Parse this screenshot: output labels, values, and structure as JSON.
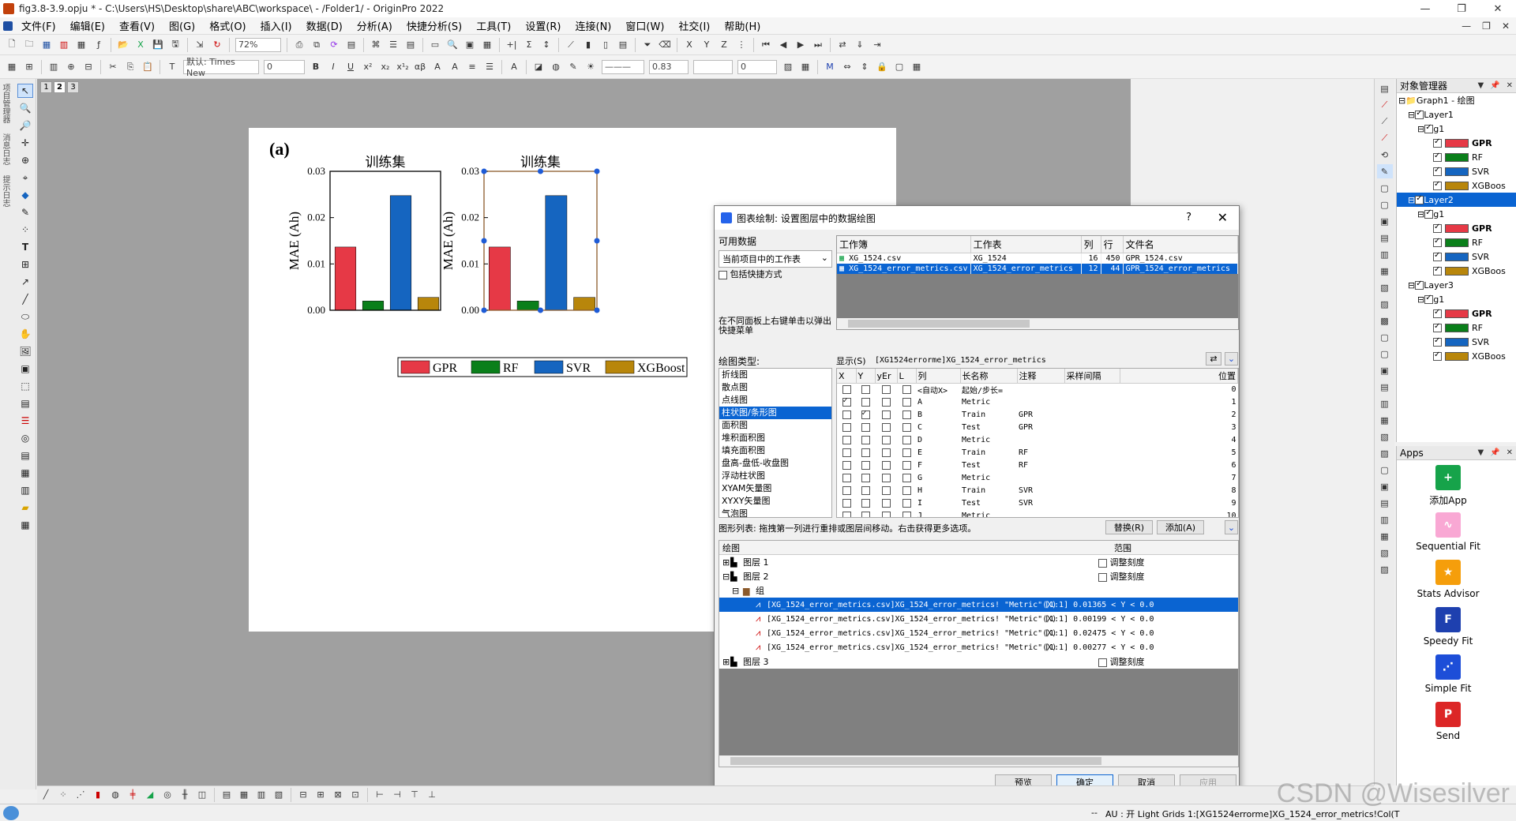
{
  "window": {
    "title": "fig3.8-3.9.opju * - C:\\Users\\HS\\Desktop\\share\\ABC\\workspace\\ - /Folder1/ - OriginPro 2022",
    "controls": [
      "—",
      "❐",
      "✕"
    ]
  },
  "menu": {
    "items": [
      "文件(F)",
      "编辑(E)",
      "查看(V)",
      "图(G)",
      "格式(O)",
      "插入(I)",
      "数据(D)",
      "分析(A)",
      "快捷分析(S)",
      "工具(T)",
      "设置(R)",
      "连接(N)",
      "窗口(W)",
      "社交(I)",
      "帮助(H)"
    ],
    "mdi_controls": [
      "—",
      "❐",
      "✕"
    ]
  },
  "toolbar": {
    "zoom": "72%",
    "font": "默认: Times New",
    "font_size": "0",
    "line_width": "0.83",
    "line_value": "0",
    "style_buttons": [
      "B",
      "I",
      "U",
      "x²",
      "x₂",
      "x¹₂",
      "αβ",
      "A",
      "A"
    ]
  },
  "left_side_labels": [
    "项目管理器",
    "消息日志",
    "提示日志"
  ],
  "page_tabs": [
    "1",
    "2",
    "3"
  ],
  "graph": {
    "panel_label": "(a)",
    "legend": [
      {
        "name": "GPR",
        "color": "#e63946"
      },
      {
        "name": "RF",
        "color": "#0a7f1a"
      },
      {
        "name": "SVR",
        "color": "#1565c0"
      },
      {
        "name": "XGBoost",
        "color": "#b8860b"
      }
    ]
  },
  "chart_data": [
    {
      "type": "bar",
      "title": "训练集",
      "ylabel": "MAE (Ah)",
      "categories": [
        "GPR",
        "RF",
        "SVR",
        "XGBoost"
      ],
      "values": [
        0.01365,
        0.00199,
        0.02475,
        0.00277
      ],
      "ylim": [
        0,
        0.03
      ],
      "yticks": [
        "0.00",
        "0.01",
        "0.02",
        "0.03"
      ],
      "colors": [
        "#e63946",
        "#0a7f1a",
        "#1565c0",
        "#b8860b"
      ]
    },
    {
      "type": "bar",
      "title": "训练集",
      "ylabel": "MAE (Ah)",
      "categories": [
        "GPR",
        "RF",
        "SVR",
        "XGBoost"
      ],
      "values": [
        0.01365,
        0.00199,
        0.02475,
        0.00277
      ],
      "ylim": [
        0,
        0.03
      ],
      "yticks": [
        "0.00",
        "0.01",
        "0.02",
        "0.03"
      ],
      "colors": [
        "#e63946",
        "#0a7f1a",
        "#1565c0",
        "#b8860b"
      ]
    }
  ],
  "dialog": {
    "title": "图表绘制: 设置图层中的数据绘图",
    "help": "?",
    "close": "✕",
    "available_data_label": "可用数据",
    "source_combo": "当前项目中的工作表",
    "include_shortcuts": "包括快捷方式",
    "right_click_hint": "在不同面板上右键单击以弹出快捷菜单",
    "workbook_headers": [
      "工作簿",
      "工作表",
      "列",
      "行",
      "文件名"
    ],
    "workbooks": [
      {
        "book": "XG_1524.csv",
        "sheet": "XG_1524",
        "cols": "16",
        "rows": "450",
        "file": "GPR_1524.csv",
        "selected": false
      },
      {
        "book": "XG_1524_error_metrics.csv",
        "sheet": "XG_1524_error_metrics",
        "cols": "12",
        "rows": "44",
        "file": "GPR_1524_error_metrics",
        "selected": true
      }
    ],
    "plot_type_label": "绘图类型:",
    "plot_types": [
      "折线图",
      "散点图",
      "点线图",
      "柱状图/条形图",
      "面积图",
      "堆积面积图",
      "填充面积图",
      "盘高-盘低-收盘图",
      "浮动柱状图",
      "XYAM矢量图",
      "XYXY矢量图",
      "气泡图"
    ],
    "plot_type_selected": 3,
    "show_label": "显示(S)",
    "show_value": "[XG1524errorme]XG_1524_error_metrics",
    "col_headers": [
      "X",
      "Y",
      "yEr",
      "L",
      "列",
      "长名称",
      "注释",
      "采样间隔",
      "位置"
    ],
    "columns": [
      {
        "x": false,
        "y": false,
        "col": "<自动X>",
        "long": "起始/步长=",
        "comment": "",
        "pos": "0"
      },
      {
        "x": true,
        "y": false,
        "col": "A",
        "long": "Metric",
        "comment": "",
        "pos": "1"
      },
      {
        "x": false,
        "y": true,
        "col": "B",
        "long": "Train",
        "comment": "GPR",
        "pos": "2"
      },
      {
        "x": false,
        "y": false,
        "col": "C",
        "long": "Test",
        "comment": "GPR",
        "pos": "3"
      },
      {
        "x": false,
        "y": false,
        "col": "D",
        "long": "Metric",
        "comment": "",
        "pos": "4"
      },
      {
        "x": false,
        "y": false,
        "col": "E",
        "long": "Train",
        "comment": "RF",
        "pos": "5"
      },
      {
        "x": false,
        "y": false,
        "col": "F",
        "long": "Test",
        "comment": "RF",
        "pos": "6"
      },
      {
        "x": false,
        "y": false,
        "col": "G",
        "long": "Metric",
        "comment": "",
        "pos": "7"
      },
      {
        "x": false,
        "y": false,
        "col": "H",
        "long": "Train",
        "comment": "SVR",
        "pos": "8"
      },
      {
        "x": false,
        "y": false,
        "col": "I",
        "long": "Test",
        "comment": "SVR",
        "pos": "9"
      },
      {
        "x": false,
        "y": false,
        "col": "J",
        "long": "Metric",
        "comment": "",
        "pos": "10"
      }
    ],
    "plotlist_hint": "图形列表: 拖拽第一列进行重排或图层间移动。右击获得更多选项。",
    "replace_btn": "替换(R)",
    "add_btn": "添加(A)",
    "plotlist_headers": [
      "绘图",
      "范围"
    ],
    "layers": [
      {
        "label": "图层 1",
        "rescale": "调整刻度"
      },
      {
        "label": "图层 2",
        "rescale": "调整刻度"
      },
      {
        "label": "图层 3",
        "rescale": "调整刻度"
      }
    ],
    "group_label": "组",
    "plots": [
      {
        "text": "[XG_1524_error_metrics.csv]XG_1524_error_metrics! \"Metric\"(X), \"Train\"(Y)",
        "range": "[1:1]  0.01365 < Y < 0.0",
        "selected": true
      },
      {
        "text": "[XG_1524_error_metrics.csv]XG_1524_error_metrics! \"Metric\"(X), \"Train\"(Y)",
        "range": "[1:1]  0.00199 < Y < 0.0",
        "selected": false
      },
      {
        "text": "[XG_1524_error_metrics.csv]XG_1524_error_metrics! \"Metric\"(X), \"Train\"(Y)",
        "range": "[1:1]  0.02475 < Y < 0.0",
        "selected": false
      },
      {
        "text": "[XG_1524_error_metrics.csv]XG_1524_error_metrics! \"Metric\"(X), \"Train\"(Y)",
        "range": "[1:1]  0.00277 < Y < 0.0",
        "selected": false
      }
    ],
    "preview_btn": "预览",
    "ok_btn": "确定",
    "cancel_btn": "取消",
    "apply_btn": "应用"
  },
  "object_manager": {
    "title": "对象管理器",
    "root": "Graph1 - 绘图",
    "layers": [
      {
        "name": "Layer1",
        "group": "g1",
        "selected": false
      },
      {
        "name": "Layer2",
        "group": "g1",
        "selected": true
      },
      {
        "name": "Layer3",
        "group": "g1",
        "selected": false
      }
    ],
    "series": [
      {
        "name": "GPR",
        "color": "#e63946",
        "bold": true
      },
      {
        "name": "RF",
        "color": "#0a7f1a",
        "bold": false
      },
      {
        "name": "SVR",
        "color": "#1565c0",
        "bold": false
      },
      {
        "name": "XGBoos",
        "color": "#b8860b",
        "bold": false
      }
    ]
  },
  "apps": {
    "title": "Apps",
    "items": [
      {
        "name": "添加App",
        "color": "#16a34a",
        "glyph": "+"
      },
      {
        "name": "Sequential Fit",
        "color": "#f9a8d4",
        "glyph": "∿"
      },
      {
        "name": "Stats Advisor",
        "color": "#f59e0b",
        "glyph": "★"
      },
      {
        "name": "Speedy Fit",
        "color": "#1e40af",
        "glyph": "F"
      },
      {
        "name": "Simple Fit",
        "color": "#1d4ed8",
        "glyph": "⋰"
      },
      {
        "name": "Send",
        "color": "#dc2626",
        "glyph": "P"
      }
    ]
  },
  "status": {
    "left": "--",
    "right": "AU : 开  Light Grids  1:[XG1524errorme]XG_1524_error_metrics!Col(T"
  },
  "watermark": "CSDN @Wisesilver"
}
